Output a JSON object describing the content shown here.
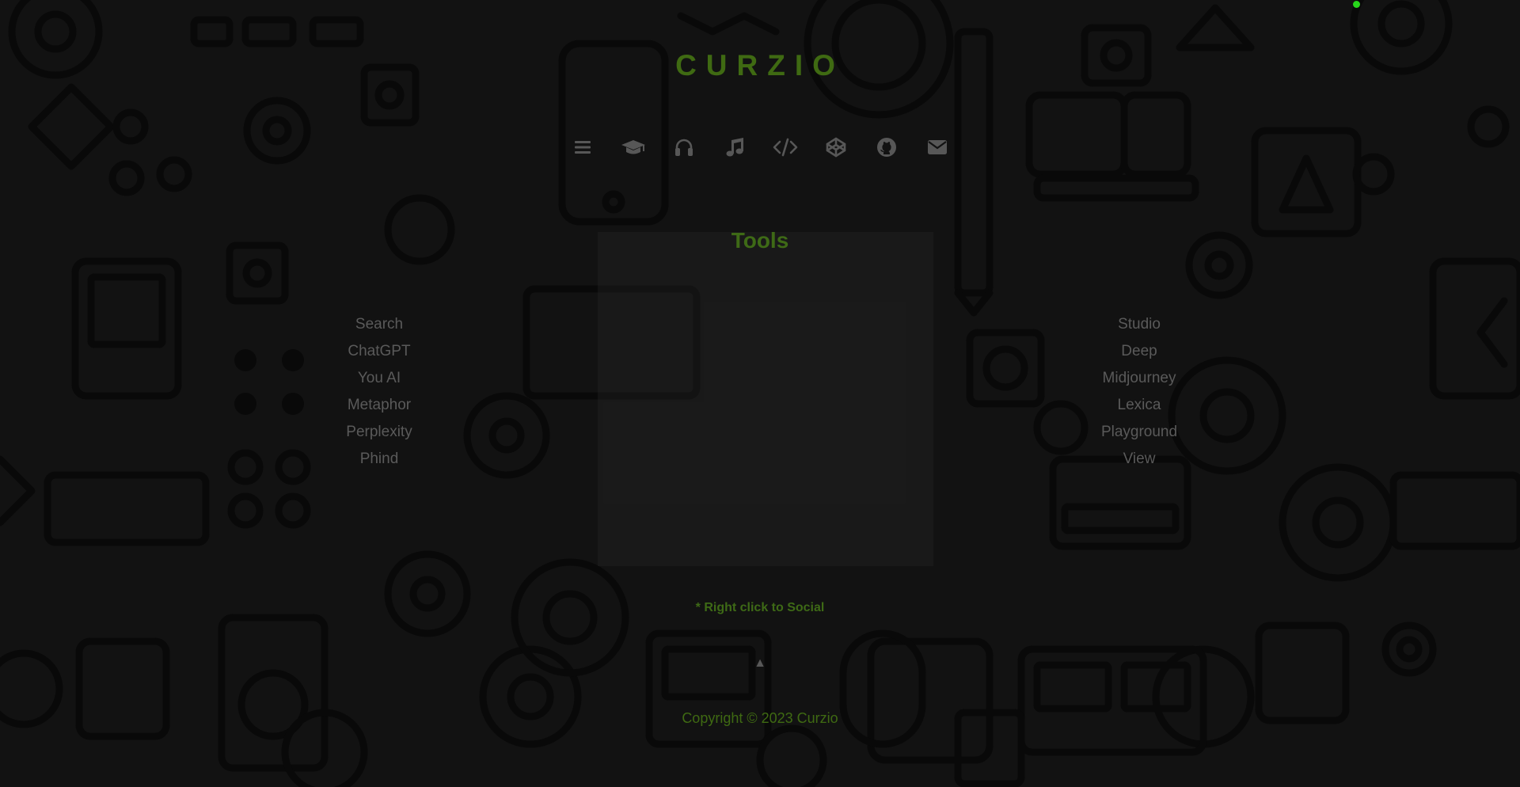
{
  "brand": {
    "title": "CURZIO"
  },
  "nav": {
    "items": [
      {
        "icon": "menu-icon"
      },
      {
        "icon": "graduation-cap-icon"
      },
      {
        "icon": "headphones-icon"
      },
      {
        "icon": "music-note-icon"
      },
      {
        "icon": "code-icon"
      },
      {
        "icon": "codepen-icon"
      },
      {
        "icon": "github-icon"
      },
      {
        "icon": "envelope-icon"
      }
    ]
  },
  "tools": {
    "title": "Tools",
    "left_links": [
      "Search",
      "ChatGPT",
      "You AI",
      "Metaphor",
      "Perplexity",
      "Phind"
    ],
    "right_links": [
      "Studio",
      "Deep",
      "Midjourney",
      "Lexica",
      "Playground",
      "View"
    ]
  },
  "footer": {
    "social_note": "* Right click to Social",
    "back_to_top": "▲",
    "copyright": "Copyright © 2023 Curzio"
  },
  "colors": {
    "background": "#121212",
    "accent": "#3f6a12",
    "link": "#5a5a5a",
    "icon": "#575757",
    "status_dot": "#27d61b"
  }
}
